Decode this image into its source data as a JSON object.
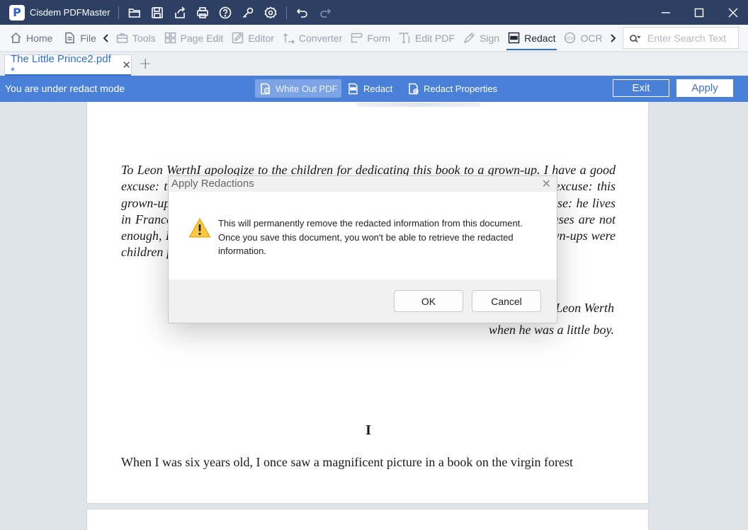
{
  "app": {
    "title": "Cisdem PDFMaster",
    "logo_letter": "P"
  },
  "title_bar": {
    "icons": [
      "open-folder-icon",
      "save-icon",
      "share-icon",
      "print-icon",
      "help-icon",
      "key-icon",
      "settings-icon",
      "undo-icon",
      "redo-icon"
    ],
    "window_controls": [
      "minimize-icon",
      "maximize-icon",
      "close-icon"
    ]
  },
  "toolbar": {
    "items": [
      {
        "label": "Home",
        "icon": "home-icon"
      },
      {
        "label": "File",
        "icon": "file-icon"
      },
      {
        "label": "Tools",
        "icon": "toolbox-icon"
      },
      {
        "label": "Page Edit",
        "icon": "grid-icon"
      },
      {
        "label": "Editor",
        "icon": "edit-icon"
      },
      {
        "label": "Converter",
        "icon": "convert-icon"
      },
      {
        "label": "Form",
        "icon": "form-icon"
      },
      {
        "label": "Edit PDF",
        "icon": "text-edit-icon"
      },
      {
        "label": "Sign",
        "icon": "sign-icon"
      },
      {
        "label": "Redact",
        "icon": "redact-icon",
        "active": true
      },
      {
        "label": "OCR",
        "icon": "ocr-icon"
      }
    ],
    "search_placeholder": "Enter Search Text"
  },
  "tabs": {
    "document_tab": "The Little Prince2.pdf *",
    "close": "✕",
    "new_tab": "+"
  },
  "redact_bar": {
    "mode_label": "You are under redact mode",
    "white_out": "White Out PDF",
    "redact": "Redact",
    "properties": "Redact Properties",
    "exit": "Exit",
    "apply": "Apply",
    "color": "#4a80d8"
  },
  "document": {
    "dedication": "To Leon WerthI apologize to the children for dedicating this book to a grown-up. I have a good excuse: this grown-up is the best friend I have in the world. I have another good excuse: this grown-up understands everything, even books for children. I have a third good excuse: he lives in France where he is hungry and cold. He needs to be comforted. If all these excuses are not enough, I will dedicate the book to the child whom this grown-up once was. All grown-ups were children first. (But few of them remember it.)",
    "signature_line1": "To Leon Werth",
    "signature_line2": "when he was a little boy.",
    "chapter": "I",
    "body_line": "When I was six years old, I once saw a magnificent picture in a book on the virgin forest"
  },
  "dialog": {
    "title": "Apply Redactions",
    "close": "✕",
    "message": "This will permanently remove the redacted information from this document. Once you save this document, you won't be able to retrieve the redacted information.",
    "ok": "OK",
    "cancel": "Cancel",
    "icon": "warning-icon"
  }
}
